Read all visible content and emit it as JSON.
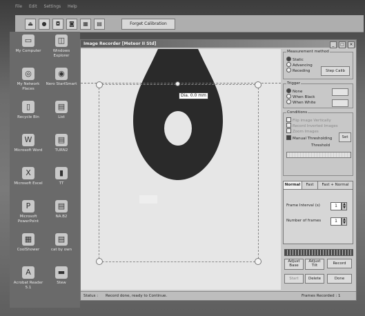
{
  "menubar": [
    "File",
    "Edit",
    "Settings",
    "Help"
  ],
  "toolbar": {
    "icons": [
      "eject-icon",
      "drop-icon",
      "camera-icon",
      "record-icon",
      "grid-icon",
      "frames-icon"
    ],
    "forget_calibration": "Forget Calibration"
  },
  "desktop": {
    "icons": [
      {
        "name": "my-computer",
        "label": "My Computer",
        "glyph": "▭"
      },
      {
        "name": "windows-explorer",
        "label": "Windows Explorer",
        "glyph": "◫"
      },
      {
        "name": "network-places",
        "label": "My Network Places",
        "glyph": "◎"
      },
      {
        "name": "start-smart",
        "label": "Nero StartSmart",
        "glyph": "◉"
      },
      {
        "name": "recycle-bin",
        "label": "Recycle Bin",
        "glyph": "▯"
      },
      {
        "name": "list",
        "label": "List",
        "glyph": "▤"
      },
      {
        "name": "microsoft-word",
        "label": "Microsoft Word",
        "glyph": "W"
      },
      {
        "name": "turn2",
        "label": "TURN2",
        "glyph": "▤"
      },
      {
        "name": "microsoft-excel",
        "label": "Microsoft Excel",
        "glyph": "X"
      },
      {
        "name": "tt",
        "label": "TT",
        "glyph": "▮"
      },
      {
        "name": "microsoft-powerpoint",
        "label": "Microsoft PowerPoint",
        "glyph": "P"
      },
      {
        "name": "na-b2",
        "label": "NA.B2",
        "glyph": "▤"
      },
      {
        "name": "coolshower",
        "label": "CoolShower",
        "glyph": "▦"
      },
      {
        "name": "cat-by-own",
        "label": "cat by own",
        "glyph": "▤"
      },
      {
        "name": "acrobat-reader",
        "label": "Acrobat Reader 5.1",
        "glyph": "A"
      },
      {
        "name": "stew",
        "label": "Stew",
        "glyph": "▬"
      }
    ]
  },
  "window": {
    "title": "Image Recorder [Meteor II Std]",
    "controls": [
      "_",
      "□",
      "×"
    ],
    "dimension_label": "Dia. 0.0 mm"
  },
  "panel": {
    "measurement_method": {
      "title": "Measurement method",
      "options": [
        "Static",
        "Advancing",
        "Receding"
      ],
      "selected": 0,
      "step_calib_label": "Step Calib"
    },
    "trigger": {
      "title": "Trigger",
      "options": [
        "None",
        "When Black",
        "When White"
      ],
      "selected": 0
    },
    "conditions": {
      "title": "Conditions",
      "checks": [
        {
          "label": "Flip image Vertically",
          "checked": false
        },
        {
          "label": "Record Inverted Images",
          "checked": false
        },
        {
          "label": "Zoom Images",
          "checked": false
        },
        {
          "label": "Manual Thresholding",
          "checked": true
        }
      ],
      "set_label": "Set",
      "threshold_label": "Threshold"
    },
    "tabs": [
      "Normal",
      "Fast",
      "Fast + Normal"
    ],
    "active_tab": 0,
    "frame_interval_label": "Frame Interval (s)",
    "frame_interval_value": "1",
    "number_of_frames_label": "Number of frames",
    "number_of_frames_value": "1",
    "progress": 1.0,
    "adjust_base_label": "Adjust Base",
    "adjust_tilt_label": "Adjust Tilt",
    "record_label": "Record",
    "start_label": "Start",
    "delete_label": "Delete",
    "done_label": "Done"
  },
  "status": {
    "label": "Status :",
    "text": "Record done, ready to Continue.",
    "frames_label": "Frames Recorded : 1"
  }
}
